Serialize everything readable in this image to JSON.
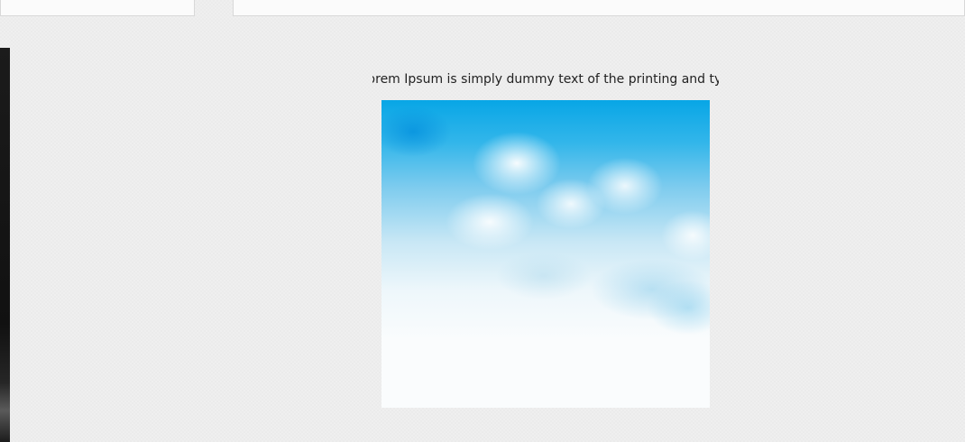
{
  "caption": {
    "text": "Lorem Ipsum is simply dummy text of the printing and typesetting industry."
  },
  "image": {
    "subject": "blue sky with soft clouds",
    "colors": {
      "sky": "#08a6e6",
      "cloud": "#fafcfd"
    }
  },
  "page": {
    "background": "#ebebeb"
  }
}
